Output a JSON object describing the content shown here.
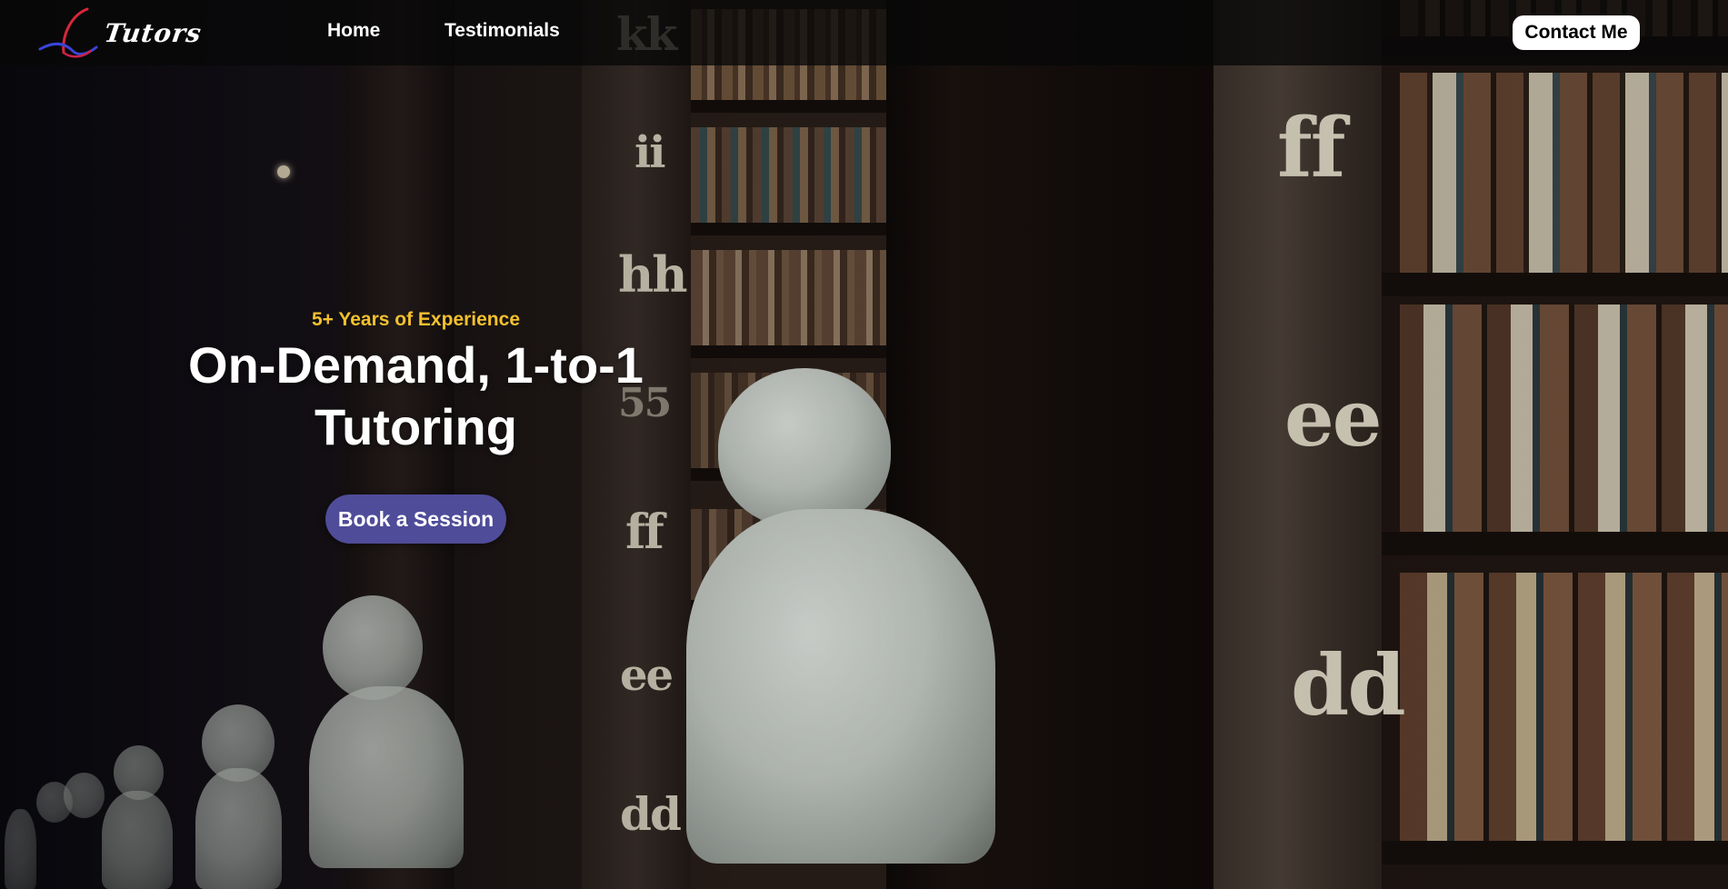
{
  "nav": {
    "logo_text": "Tutors",
    "links": [
      "Home",
      "Testimonials"
    ],
    "contact_label": "Contact Me"
  },
  "hero": {
    "eyebrow": "5+ Years of Experience",
    "headline_line1": "On-Demand, 1-to-1",
    "headline_line2": "Tutoring",
    "cta_label": "Book a Session"
  },
  "background": {
    "shelf_labels": [
      "kk",
      "ii",
      "hh",
      "55",
      "ff",
      "ee",
      "dd",
      "ff",
      "ee",
      "dd"
    ]
  },
  "colors": {
    "eyebrow": "#f2c12e",
    "cta_background": "#4f4c99",
    "nav_background": "rgba(8,8,8,0.78)"
  }
}
